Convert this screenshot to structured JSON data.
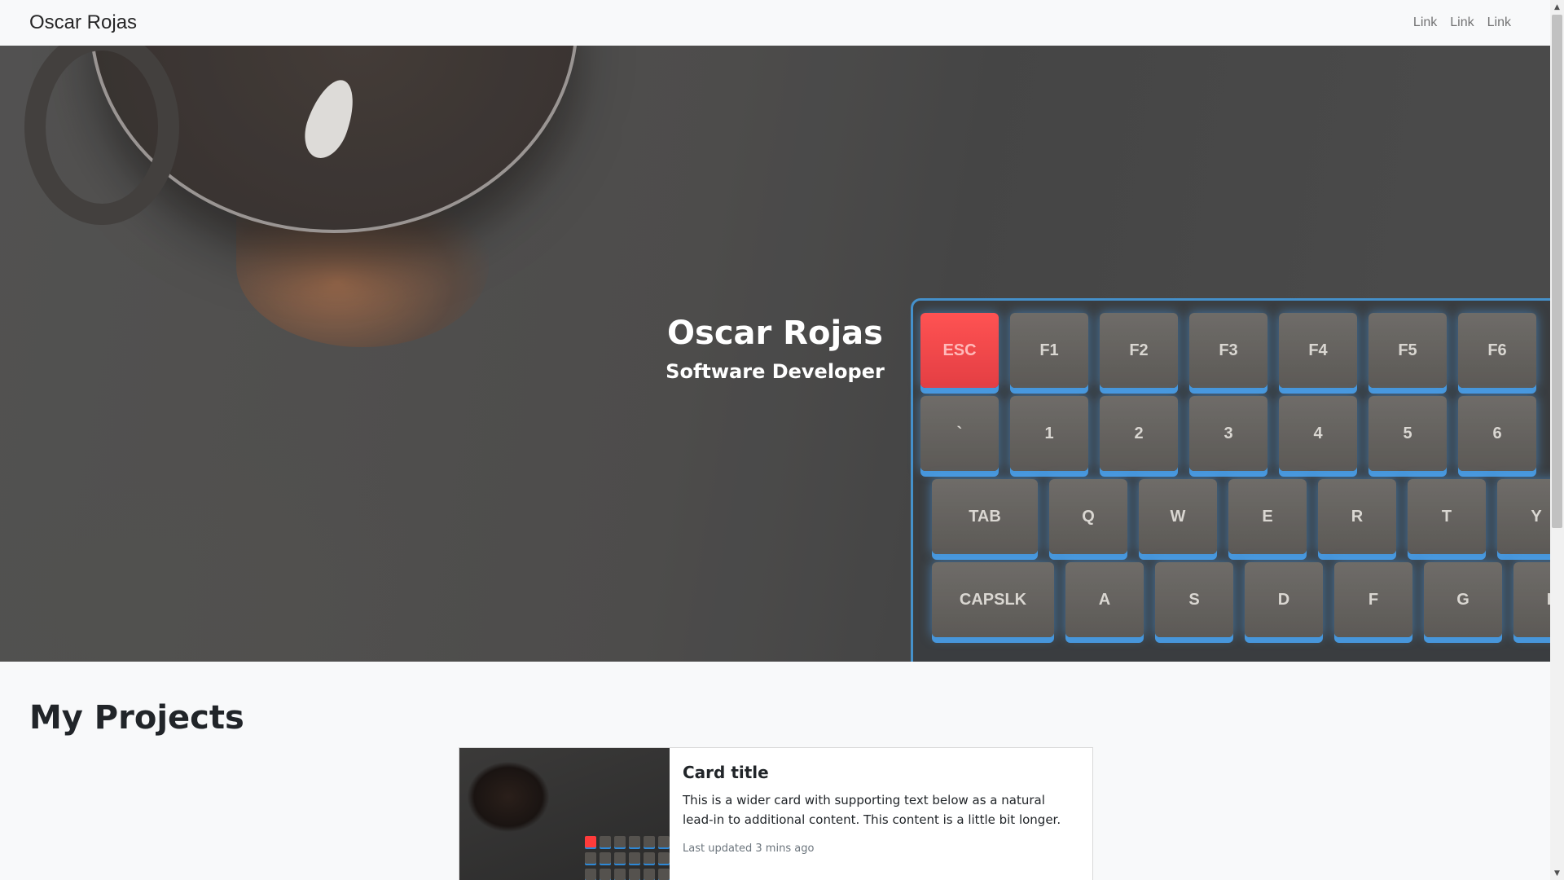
{
  "navbar": {
    "brand": "Oscar Rojas",
    "links": [
      {
        "label": "Link"
      },
      {
        "label": "Link"
      },
      {
        "label": "Link"
      }
    ]
  },
  "hero": {
    "title": "Oscar Rojas",
    "subtitle": "Software Developer",
    "keys_row1": [
      "ESC",
      "F1",
      "F2",
      "F3",
      "F4",
      "F5",
      "F6"
    ],
    "keys_row2": [
      "`",
      "1",
      "2",
      "3",
      "4",
      "5",
      "6"
    ],
    "keys_row3": [
      "TAB",
      "Q",
      "W",
      "E",
      "R",
      "T",
      "Y"
    ],
    "keys_row4": [
      "CAPSLK",
      "A",
      "S",
      "D",
      "F",
      "G",
      "H"
    ]
  },
  "projects": {
    "heading": "My Projects",
    "cards": [
      {
        "title": "Card title",
        "text": "This is a wider card with supporting text below as a natural lead-in to additional content. This content is a little bit longer.",
        "updated": "Last updated 3 mins ago"
      }
    ]
  },
  "colors": {
    "navbar_bg": "#f8f9fa",
    "esc_key": "#ff3b3b",
    "key_glow": "#2e88d6"
  }
}
